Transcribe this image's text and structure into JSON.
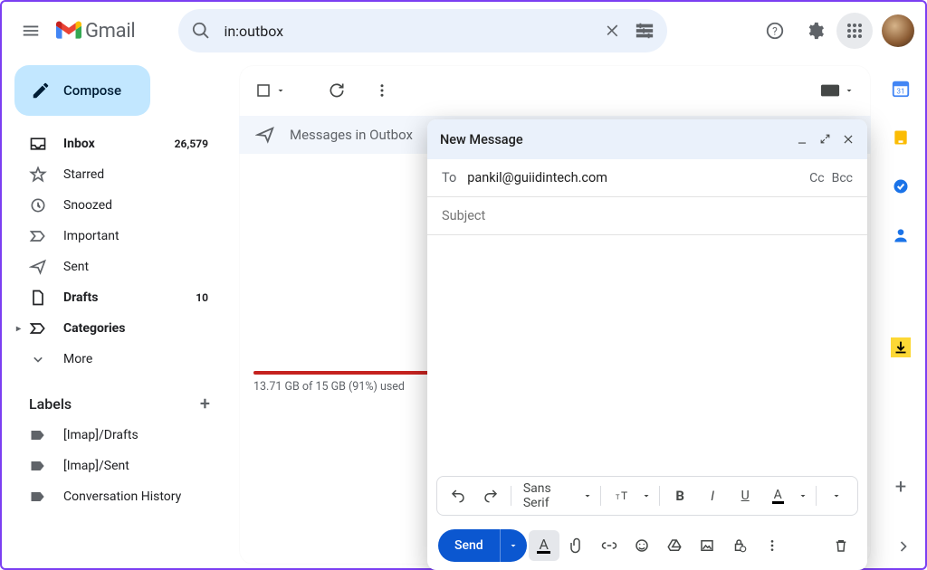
{
  "header": {
    "brand": "Gmail",
    "search_value": "in:outbox"
  },
  "sidebar": {
    "compose_label": "Compose",
    "items": [
      {
        "label": "Inbox",
        "count": "26,579",
        "bold": true
      },
      {
        "label": "Starred"
      },
      {
        "label": "Snoozed"
      },
      {
        "label": "Important"
      },
      {
        "label": "Sent"
      },
      {
        "label": "Drafts",
        "count": "10",
        "bold": true
      },
      {
        "label": "Categories",
        "bold": true,
        "caret": true
      },
      {
        "label": "More"
      }
    ],
    "labels_header": "Labels",
    "labels": [
      {
        "label": "[Imap]/Drafts"
      },
      {
        "label": "[Imap]/Sent"
      },
      {
        "label": "Conversation History"
      }
    ]
  },
  "main": {
    "section_header": "Messages in Outbox",
    "storage_text": "13.71 GB of 15 GB (91%) used",
    "storage_pct": 91
  },
  "compose_window": {
    "title": "New Message",
    "to_label": "To",
    "to_value": "pankil@guiidintech.com",
    "cc_label": "Cc",
    "bcc_label": "Bcc",
    "subject_placeholder": "Subject",
    "font_name": "Sans Serif",
    "send_label": "Send"
  },
  "rail": {
    "calendar_day": "31"
  }
}
